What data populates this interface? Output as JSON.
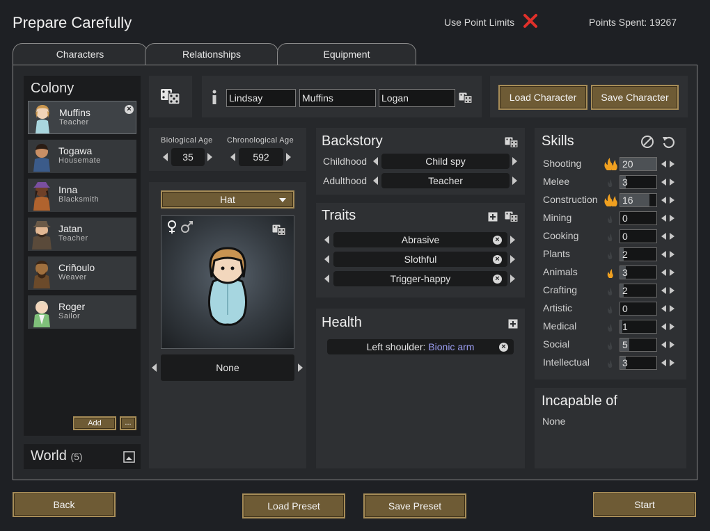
{
  "header": {
    "title": "Prepare Carefully",
    "use_point_limits": "Use Point Limits",
    "points_spent": "Points Spent: 19267"
  },
  "tabs": [
    {
      "label": "Characters",
      "active": true
    },
    {
      "label": "Relationships",
      "active": false
    },
    {
      "label": "Equipment",
      "active": false
    }
  ],
  "colony": {
    "title": "Colony",
    "pawns": [
      {
        "name": "Muffins",
        "role": "Teacher",
        "selected": true
      },
      {
        "name": "Togawa",
        "role": "Housemate"
      },
      {
        "name": "Inna",
        "role": "Blacksmith"
      },
      {
        "name": "Jatan",
        "role": "Teacher"
      },
      {
        "name": "Criñoulo",
        "role": "Weaver"
      },
      {
        "name": "Roger",
        "role": "Sailor"
      }
    ],
    "add_label": "Add",
    "more_label": "..."
  },
  "world": {
    "title": "World",
    "count": "(5)"
  },
  "name_fields": {
    "first": "Lindsay",
    "nick": "Muffins",
    "last": "Logan"
  },
  "char_buttons": {
    "load": "Load Character",
    "save": "Save Character"
  },
  "age": {
    "bio_label": "Biological Age",
    "bio_value": "35",
    "chrono_label": "Chronological Age",
    "chrono_value": "592"
  },
  "apparel": {
    "layer": "Hat",
    "item": "None"
  },
  "backstory": {
    "title": "Backstory",
    "childhood_label": "Childhood",
    "childhood_value": "Child spy",
    "adulthood_label": "Adulthood",
    "adulthood_value": "Teacher"
  },
  "traits": {
    "title": "Traits",
    "items": [
      "Abrasive",
      "Slothful",
      "Trigger-happy"
    ]
  },
  "health": {
    "title": "Health",
    "items": [
      {
        "part": "Left shoulder: ",
        "condition": "Bionic arm"
      }
    ]
  },
  "skills": {
    "title": "Skills",
    "items": [
      {
        "name": "Shooting",
        "value": "20",
        "passion": "major",
        "level": 20
      },
      {
        "name": "Melee",
        "value": "3",
        "passion": "none",
        "level": 3
      },
      {
        "name": "Construction",
        "value": "16",
        "passion": "major",
        "level": 16
      },
      {
        "name": "Mining",
        "value": "0",
        "passion": "none",
        "level": 0
      },
      {
        "name": "Cooking",
        "value": "0",
        "passion": "none",
        "level": 0
      },
      {
        "name": "Plants",
        "value": "2",
        "passion": "none",
        "level": 2
      },
      {
        "name": "Animals",
        "value": "3",
        "passion": "minor",
        "level": 3
      },
      {
        "name": "Crafting",
        "value": "2",
        "passion": "none",
        "level": 2
      },
      {
        "name": "Artistic",
        "value": "0",
        "passion": "none",
        "level": 0
      },
      {
        "name": "Medical",
        "value": "1",
        "passion": "none",
        "level": 1
      },
      {
        "name": "Social",
        "value": "5",
        "passion": "none",
        "level": 5
      },
      {
        "name": "Intellectual",
        "value": "3",
        "passion": "none",
        "level": 3
      }
    ]
  },
  "incapable": {
    "title": "Incapable of",
    "value": "None"
  },
  "footer": {
    "back": "Back",
    "load_preset": "Load Preset",
    "save_preset": "Save Preset",
    "start": "Start"
  },
  "colors": {
    "gold_button": "#6e5b35",
    "gold_border": "#a78d58",
    "passion_flame": "#f0a020",
    "close_red": "#e0302a",
    "bionic_blue": "#9a9cf0"
  }
}
